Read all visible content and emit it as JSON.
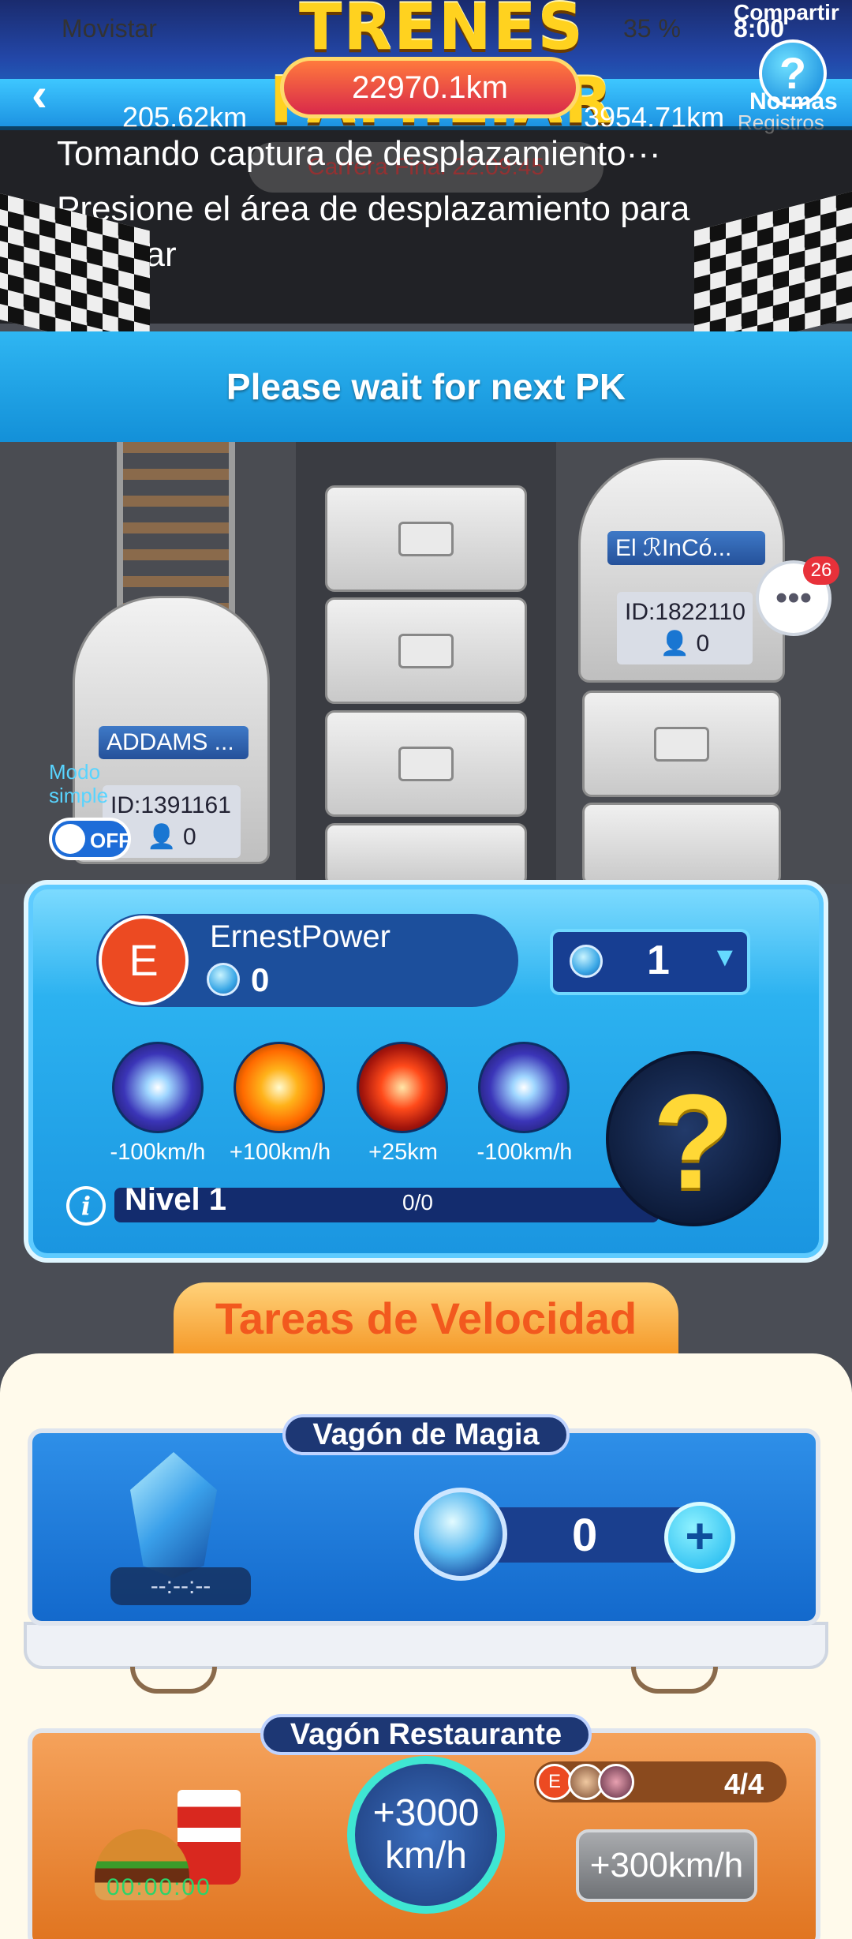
{
  "status_bar": {
    "carrier": "Movistar",
    "battery": "35 %",
    "time": "8:00"
  },
  "header": {
    "title": "TRENES FAMILIAR",
    "share_label": "Compartir",
    "total_distance": "22970.1km",
    "left_distance": "205.62km",
    "right_distance": "3954.71km",
    "rules_label": "Normas",
    "records_label": "Registros"
  },
  "overlay": {
    "line1": "Tomando captura de desplazamiento···",
    "line2": "Presione el área de desplazamiento para finalizar",
    "final_race": "Carrera Final 22:09:45"
  },
  "pk_banner": "Please wait for next PK",
  "trains": {
    "left": {
      "name": "ADDAMS ...",
      "id": "ID:1391161",
      "riders": "0"
    },
    "right": {
      "name": "El ℛInCó...",
      "id": "ID:1822110",
      "riders": "0"
    }
  },
  "chat": {
    "badge": "26"
  },
  "mode": {
    "label": "Modo simple",
    "state": "OFF"
  },
  "player": {
    "avatar_letter": "E",
    "name": "ErnestPower",
    "gems": "0",
    "quantity": "1",
    "skills": [
      "-100km/h",
      "+100km/h",
      "+25km",
      "-100km/h"
    ],
    "level": "Nivel 1",
    "level_progress": "0/0",
    "mystery": "?"
  },
  "tasks": {
    "title": "Tareas de Velocidad",
    "magic": {
      "title": "Vagón de Magia",
      "timer": "--:--:--",
      "count": "0"
    },
    "restaurant": {
      "title": "Vagón Restaurante",
      "timer": "00:00:00",
      "boost_line1": "+3000",
      "boost_line2": "km/h",
      "member_letter": "E",
      "team_count": "4/4",
      "action": "+300km/h"
    }
  }
}
